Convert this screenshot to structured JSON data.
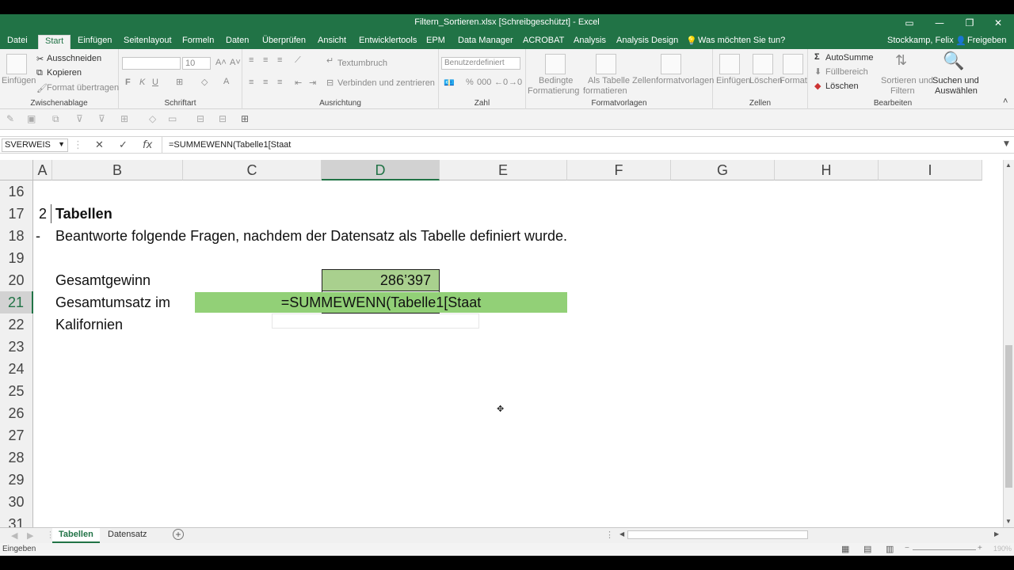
{
  "window": {
    "title": "Filtern_Sortieren.xlsx  [Schreibgeschützt] - Excel",
    "user": "Stockkamp, Felix",
    "share": "Freigeben"
  },
  "ribbon_tabs": [
    "Datei",
    "Start",
    "Einfügen",
    "Seitenlayout",
    "Formeln",
    "Daten",
    "Überprüfen",
    "Ansicht",
    "Entwicklertools",
    "EPM",
    "Data Manager",
    "ACROBAT",
    "Analysis",
    "Analysis Design"
  ],
  "tell_me": "Was möchten Sie tun?",
  "ribbon": {
    "clipboard": {
      "paste": "Einfügen",
      "cut": "Ausschneiden",
      "copy": "Kopieren",
      "format_painter": "Format übertragen",
      "group": "Zwischenablage"
    },
    "font": {
      "size": "10",
      "bold": "F",
      "italic": "K",
      "underline": "U",
      "group": "Schriftart"
    },
    "alignment": {
      "wrap": "Textumbruch",
      "merge": "Verbinden und zentrieren",
      "group": "Ausrichtung"
    },
    "number": {
      "format": "Benutzerdefiniert",
      "percent": "%",
      "thousands": "000",
      "group": "Zahl"
    },
    "styles": {
      "conditional_1": "Bedingte",
      "conditional_2": "Formatierung",
      "table_1": "Als Tabelle",
      "table_2": "formatieren",
      "cell_styles": "Zellenformatvorlagen",
      "group": "Formatvorlagen"
    },
    "cells": {
      "insert": "Einfügen",
      "delete": "Löschen",
      "format": "Format",
      "group": "Zellen"
    },
    "editing": {
      "autosum": "AutoSumme",
      "fill": "Füllbereich",
      "clear": "Löschen",
      "sort_1": "Sortieren und",
      "sort_2": "Filtern",
      "find_1": "Suchen und",
      "find_2": "Auswählen",
      "group": "Bearbeiten"
    }
  },
  "formula_bar": {
    "name_box": "SVERWEIS",
    "formula": "=SUMMEWENN(Tabelle1[Staat"
  },
  "columns": [
    "A",
    "B",
    "C",
    "D",
    "E",
    "F",
    "G",
    "H",
    "I"
  ],
  "selected_column": "D",
  "rows": [
    "16",
    "17",
    "18",
    "19",
    "20",
    "21",
    "22",
    "23",
    "24",
    "25",
    "26",
    "27",
    "28",
    "29",
    "30",
    "31"
  ],
  "selected_row": "21",
  "cells": {
    "a17": "2",
    "b17": "Tabellen",
    "a18": "-",
    "b18": "Beantworte folgende Fragen, nachdem der Datensatz als Tabelle definiert wurde.",
    "b20": "Gesamtgewinn",
    "d20": "286’397",
    "b21": "Gesamtumsatz im",
    "edit21": "=SUMMEWENN(Tabelle1[Staat",
    "b22": "Kalifornien"
  },
  "colors": {
    "excel_green": "#217346",
    "cell_fill": "#a9d08e",
    "edit_fill": "#92d077"
  },
  "sheets": [
    "Tabellen",
    "Datensatz"
  ],
  "active_sheet": "Tabellen",
  "status": "Eingeben",
  "zoom": "190%"
}
